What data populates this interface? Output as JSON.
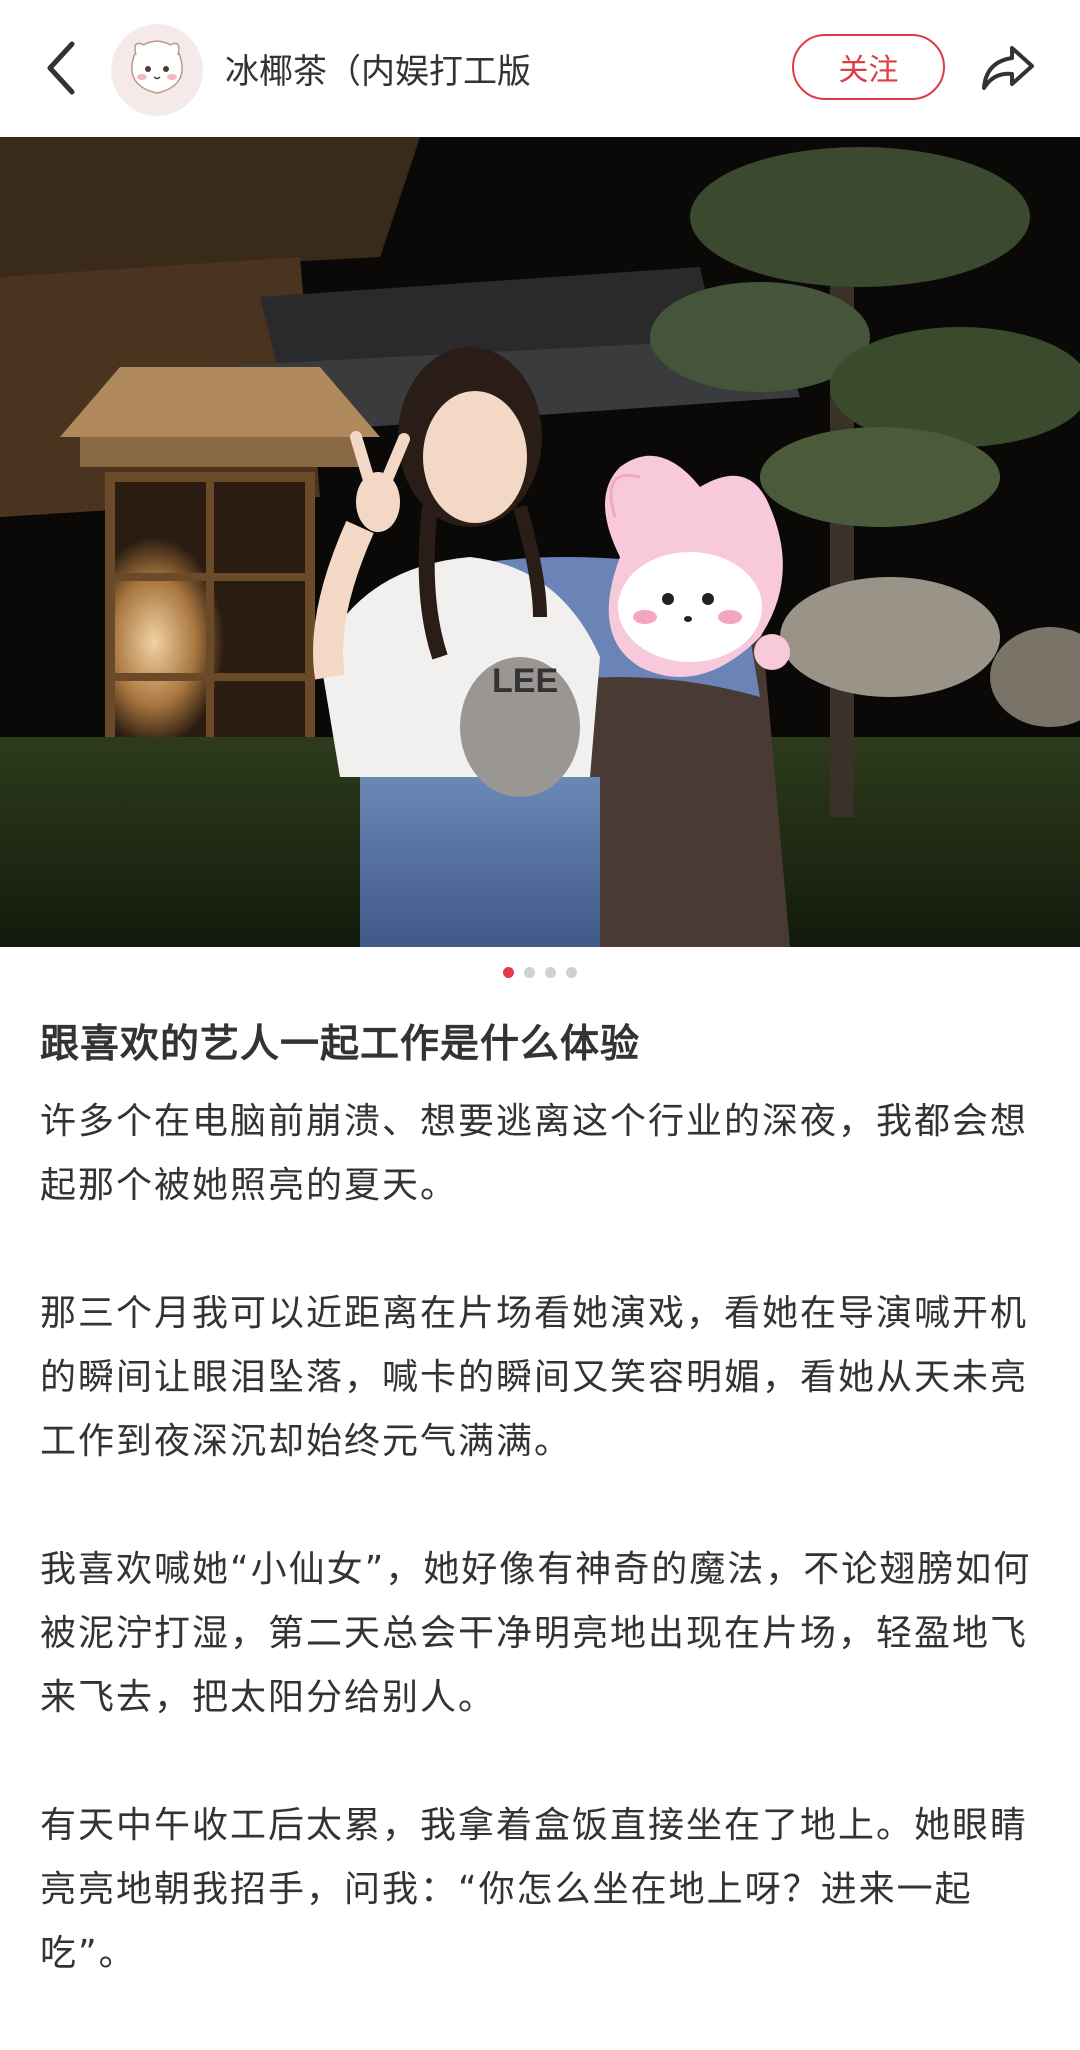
{
  "header": {
    "author_name": "冰椰茶（内娱打工版",
    "follow_label": "关注"
  },
  "carousel": {
    "count": 4,
    "active_index": 0
  },
  "post": {
    "title": "跟喜欢的艺人一起工作是什么体验",
    "paragraphs": [
      "许多个在电脑前崩溃、想要逃离这个行业的深夜，我都会想起那个被她照亮的夏天。",
      "那三个月我可以近距离在片场看她演戏，看她在导演喊开机的瞬间让眼泪坠落，喊卡的瞬间又笑容明媚，看她从天未亮工作到夜深沉却始终元气满满。",
      "我喜欢喊她“小仙女”，她好像有神奇的魔法，不论翅膀如何被泥泞打湿，第二天总会干净明亮地出现在片场，轻盈地飞来飞去，把太阳分给别人。",
      "有天中午收工后太累，我拿着盒饭直接坐在了地上。她眼睛亮亮地朝我招手，问我：“你怎么坐在地上呀？进来一起吃”。"
    ]
  },
  "colors": {
    "accent": "#e03c45",
    "text": "#333333"
  },
  "photo_overlay_text": "LEE"
}
